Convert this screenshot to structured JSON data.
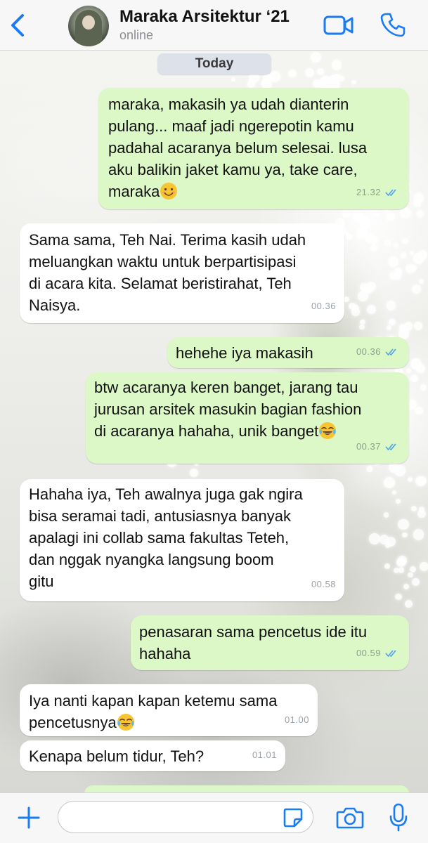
{
  "header": {
    "contact_name": "Maraka Arsitektur ‘21",
    "status": "online",
    "icons": [
      "chevron-left-icon",
      "video-camera-icon",
      "phone-icon"
    ],
    "accent_color": "#1a7cf5"
  },
  "chat": {
    "date_label": "Today",
    "messages": [
      {
        "direction": "outgoing",
        "lines": [
          "maraka, makasih ya udah dianterin",
          "pulang... maaf jadi ngerepotin kamu",
          "padahal acaranya belum selesai. lusa",
          "aku balikin jaket kamu ya, take care,",
          "maraka"
        ],
        "emoji": "smiling-face-icon",
        "time": "21.32",
        "read": true
      },
      {
        "direction": "incoming",
        "lines": [
          "Sama sama, Teh Nai. Terima kasih udah",
          "meluangkan waktu untuk berpartisipasi",
          "di acara kita. Selamat beristirahat, Teh",
          "Naisya."
        ],
        "time": "00.36"
      },
      {
        "direction": "outgoing",
        "lines": [
          "hehehe iya makasih"
        ],
        "time": "00.36",
        "read": true
      },
      {
        "direction": "outgoing",
        "lines": [
          "btw acaranya keren banget, jarang tau",
          "jurusan arsitek masukin bagian fashion",
          "di acaranya hahaha, unik banget"
        ],
        "emoji": "tears-of-joy-icon",
        "time": "00.37",
        "read": true
      },
      {
        "direction": "incoming",
        "lines": [
          "Hahaha iya, Teh awalnya juga gak ngira",
          "bisa seramai tadi, antusiasnya banyak",
          "apalagi ini collab sama fakultas Teteh,",
          "dan nggak nyangka langsung boom",
          "gitu"
        ],
        "time": "00.58"
      },
      {
        "direction": "outgoing",
        "lines": [
          "penasaran sama pencetus ide itu",
          "hahaha"
        ],
        "time": "00.59",
        "read": true
      },
      {
        "direction": "incoming",
        "lines": [
          "Iya nanti kapan kapan ketemu sama",
          "pencetusnya"
        ],
        "emoji": "tears-of-joy-icon",
        "time": "01.00"
      },
      {
        "direction": "incoming",
        "lines": [
          "Kenapa belum tidur, Teh?"
        ],
        "time": "01.01"
      }
    ]
  },
  "composer": {
    "value": "",
    "placeholder": "",
    "icons": [
      "plus-icon",
      "sticker-icon",
      "camera-icon",
      "microphone-icon"
    ]
  }
}
